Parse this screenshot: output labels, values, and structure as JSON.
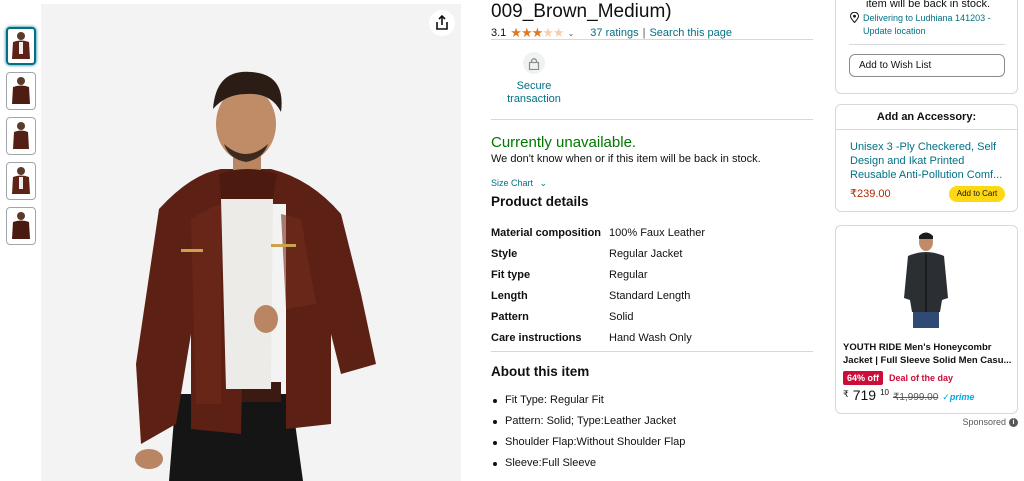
{
  "product": {
    "title": "009_Brown_Medium)",
    "rating_value": "3.1",
    "ratings_link": "37 ratings",
    "search_link": "Search this page",
    "rating_separator": "|"
  },
  "secure": {
    "label_line1": "Secure",
    "label_line2": "transaction"
  },
  "availability": {
    "status": "Currently unavailable.",
    "note": "We don't know when or if this item will be back in stock."
  },
  "size_chart": {
    "label": "Size Chart"
  },
  "product_details": {
    "heading": "Product details",
    "rows": [
      {
        "key": "Material composition",
        "value": "100% Faux Leather"
      },
      {
        "key": "Style",
        "value": "Regular Jacket"
      },
      {
        "key": "Fit type",
        "value": "Regular"
      },
      {
        "key": "Length",
        "value": "Standard Length"
      },
      {
        "key": "Pattern",
        "value": "Solid"
      },
      {
        "key": "Care instructions",
        "value": "Hand Wash Only"
      }
    ]
  },
  "about": {
    "heading": "About this item",
    "items": [
      "Fit Type: Regular Fit",
      "Pattern: Solid; Type:Leather Jacket",
      "Shoulder Flap:Without Shoulder Flap",
      "Sleeve:Full Sleeve"
    ]
  },
  "buybox": {
    "stock_line": "item will be back in stock.",
    "deliver_line1": "Delivering to Ludhiana 141203 -",
    "deliver_line2": "Update location",
    "wishlist_label": "Add to Wish List"
  },
  "accessory": {
    "heading": "Add an Accessory:",
    "title": "Unisex 3 -Ply Checkered, Self Design and Ikat Printed Reusable Anti-Pollution Comf...",
    "price": "₹239.00",
    "add_to_cart": "Add to Cart"
  },
  "ad": {
    "title": "YOUTH RIDE Men's Honeycombr Jacket | Full Sleeve Solid Men Casu...",
    "discount_badge": "64% off",
    "deal_label": "Deal of the day",
    "price_symbol": "₹",
    "price_whole": "719",
    "price_fraction": "10",
    "mrp": "₹1,999.00",
    "prime": "✓prime",
    "sponsored": "Sponsored"
  },
  "colors": {
    "link": "#007185",
    "available_green": "#007600",
    "price_red": "#b12704",
    "deal_red": "#cc0c39",
    "cart_yellow": "#ffd814",
    "star_orange": "#de7921"
  },
  "icons": [
    "share-icon",
    "lock-icon",
    "star-icon",
    "chevron-down-icon",
    "location-pin-icon",
    "info-icon"
  ]
}
